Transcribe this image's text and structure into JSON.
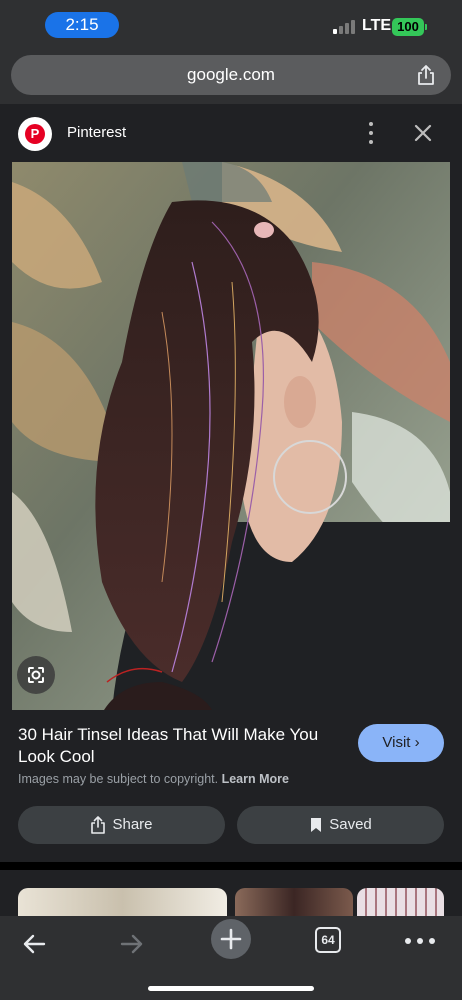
{
  "status_bar": {
    "time": "2:15",
    "network": "LTE",
    "battery": "100"
  },
  "browser": {
    "url": "google.com"
  },
  "source": {
    "name": "Pinterest",
    "logo_letter": "P"
  },
  "result": {
    "title": "30 Hair Tinsel Ideas That Will Make You Look Cool",
    "visit_label": "Visit ›",
    "copyright_text": "Images may be subject to copyright.",
    "learn_more": "Learn More",
    "share_label": "Share",
    "saved_label": "Saved"
  },
  "toolbar": {
    "tab_count": "64"
  },
  "colors": {
    "accent": "#8ab4f8",
    "time_pill": "#1a73e8",
    "battery": "#34c759",
    "pinterest": "#e60023"
  }
}
